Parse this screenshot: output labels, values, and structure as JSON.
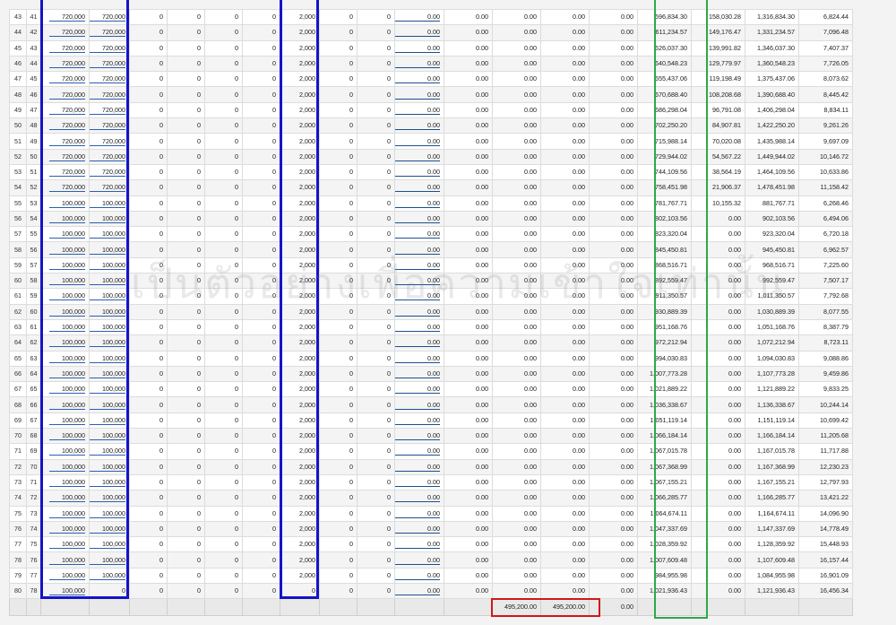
{
  "watermark": "เป็นตัวอย่างเพื่อความเข้าใจเท่านั้น",
  "highlight_colors": {
    "blue": "#1414c8",
    "green": "#2ea84a",
    "red": "#d01818"
  },
  "rows": [
    [
      "43",
      "41",
      "720,000",
      "720,000",
      "0",
      "0",
      "0",
      "0",
      "2,000",
      "0",
      "0",
      "0.00",
      "0.00",
      "0.00",
      "0.00",
      "0.00",
      "596,834.30",
      "158,030.28",
      "1,316,834.30",
      "6,824.44"
    ],
    [
      "44",
      "42",
      "720,000",
      "720,000",
      "0",
      "0",
      "0",
      "0",
      "2,000",
      "0",
      "0",
      "0.00",
      "0.00",
      "0.00",
      "0.00",
      "0.00",
      "611,234.57",
      "149,176.47",
      "1,331,234.57",
      "7,096.48"
    ],
    [
      "45",
      "43",
      "720,000",
      "720,000",
      "0",
      "0",
      "0",
      "0",
      "2,000",
      "0",
      "0",
      "0.00",
      "0.00",
      "0.00",
      "0.00",
      "0.00",
      "626,037.30",
      "139,991.82",
      "1,346,037.30",
      "7,407.37"
    ],
    [
      "46",
      "44",
      "720,000",
      "720,000",
      "0",
      "0",
      "0",
      "0",
      "2,000",
      "0",
      "0",
      "0.00",
      "0.00",
      "0.00",
      "0.00",
      "0.00",
      "640,548.23",
      "129,779.97",
      "1,360,548.23",
      "7,726.05"
    ],
    [
      "47",
      "45",
      "720,000",
      "720,000",
      "0",
      "0",
      "0",
      "0",
      "2,000",
      "0",
      "0",
      "0.00",
      "0.00",
      "0.00",
      "0.00",
      "0.00",
      "655,437.06",
      "119,198.49",
      "1,375,437.06",
      "8,073.62"
    ],
    [
      "48",
      "46",
      "720,000",
      "720,000",
      "0",
      "0",
      "0",
      "0",
      "2,000",
      "0",
      "0",
      "0.00",
      "0.00",
      "0.00",
      "0.00",
      "0.00",
      "670,688.40",
      "108,208.68",
      "1,390,688.40",
      "8,445.42"
    ],
    [
      "49",
      "47",
      "720,000",
      "720,000",
      "0",
      "0",
      "0",
      "0",
      "2,000",
      "0",
      "0",
      "0.00",
      "0.00",
      "0.00",
      "0.00",
      "0.00",
      "686,298.04",
      "96,791.08",
      "1,406,298.04",
      "8,834.11"
    ],
    [
      "50",
      "48",
      "720,000",
      "720,000",
      "0",
      "0",
      "0",
      "0",
      "2,000",
      "0",
      "0",
      "0.00",
      "0.00",
      "0.00",
      "0.00",
      "0.00",
      "702,250.20",
      "84,907.81",
      "1,422,250.20",
      "9,261.26"
    ],
    [
      "51",
      "49",
      "720,000",
      "720,000",
      "0",
      "0",
      "0",
      "0",
      "2,000",
      "0",
      "0",
      "0.00",
      "0.00",
      "0.00",
      "0.00",
      "0.00",
      "715,988.14",
      "70,020.08",
      "1,435,988.14",
      "9,697.09"
    ],
    [
      "52",
      "50",
      "720,000",
      "720,000",
      "0",
      "0",
      "0",
      "0",
      "2,000",
      "0",
      "0",
      "0.00",
      "0.00",
      "0.00",
      "0.00",
      "0.00",
      "729,944.02",
      "54,567.22",
      "1,449,944.02",
      "10,146.72"
    ],
    [
      "53",
      "51",
      "720,000",
      "720,000",
      "0",
      "0",
      "0",
      "0",
      "2,000",
      "0",
      "0",
      "0.00",
      "0.00",
      "0.00",
      "0.00",
      "0.00",
      "744,109.56",
      "38,564.19",
      "1,464,109.56",
      "10,633.86"
    ],
    [
      "54",
      "52",
      "720,000",
      "720,000",
      "0",
      "0",
      "0",
      "0",
      "2,000",
      "0",
      "0",
      "0.00",
      "0.00",
      "0.00",
      "0.00",
      "0.00",
      "758,451.98",
      "21,906.37",
      "1,478,451.98",
      "11,158.42"
    ],
    [
      "55",
      "53",
      "100,000",
      "100,000",
      "0",
      "0",
      "0",
      "0",
      "2,000",
      "0",
      "0",
      "0.00",
      "0.00",
      "0.00",
      "0.00",
      "0.00",
      "781,767.71",
      "10,155.32",
      "881,767.71",
      "6,268.46"
    ],
    [
      "56",
      "54",
      "100,000",
      "100,000",
      "0",
      "0",
      "0",
      "0",
      "2,000",
      "0",
      "0",
      "0.00",
      "0.00",
      "0.00",
      "0.00",
      "0.00",
      "802,103.56",
      "0.00",
      "902,103.56",
      "6,494.06"
    ],
    [
      "57",
      "55",
      "100,000",
      "100,000",
      "0",
      "0",
      "0",
      "0",
      "2,000",
      "0",
      "0",
      "0.00",
      "0.00",
      "0.00",
      "0.00",
      "0.00",
      "823,320.04",
      "0.00",
      "923,320.04",
      "6,720.18"
    ],
    [
      "58",
      "56",
      "100,000",
      "100,000",
      "0",
      "0",
      "0",
      "0",
      "2,000",
      "0",
      "0",
      "0.00",
      "0.00",
      "0.00",
      "0.00",
      "0.00",
      "845,450.81",
      "0.00",
      "945,450.81",
      "6,962.57"
    ],
    [
      "59",
      "57",
      "100,000",
      "100,000",
      "0",
      "0",
      "0",
      "0",
      "2,000",
      "0",
      "0",
      "0.00",
      "0.00",
      "0.00",
      "0.00",
      "0.00",
      "868,516.71",
      "0.00",
      "968,516.71",
      "7,225.60"
    ],
    [
      "60",
      "58",
      "100,000",
      "100,000",
      "0",
      "0",
      "0",
      "0",
      "2,000",
      "0",
      "0",
      "0.00",
      "0.00",
      "0.00",
      "0.00",
      "0.00",
      "892,559.47",
      "0.00",
      "992,559.47",
      "7,507.17"
    ],
    [
      "61",
      "59",
      "100,000",
      "100,000",
      "0",
      "0",
      "0",
      "0",
      "2,000",
      "0",
      "0",
      "0.00",
      "0.00",
      "0.00",
      "0.00",
      "0.00",
      "911,350.57",
      "0.00",
      "1,011,350.57",
      "7,792.68"
    ],
    [
      "62",
      "60",
      "100,000",
      "100,000",
      "0",
      "0",
      "0",
      "0",
      "2,000",
      "0",
      "0",
      "0.00",
      "0.00",
      "0.00",
      "0.00",
      "0.00",
      "930,889.39",
      "0.00",
      "1,030,889.39",
      "8,077.55"
    ],
    [
      "63",
      "61",
      "100,000",
      "100,000",
      "0",
      "0",
      "0",
      "0",
      "2,000",
      "0",
      "0",
      "0.00",
      "0.00",
      "0.00",
      "0.00",
      "0.00",
      "951,168.76",
      "0.00",
      "1,051,168.76",
      "8,387.79"
    ],
    [
      "64",
      "62",
      "100,000",
      "100,000",
      "0",
      "0",
      "0",
      "0",
      "2,000",
      "0",
      "0",
      "0.00",
      "0.00",
      "0.00",
      "0.00",
      "0.00",
      "972,212.94",
      "0.00",
      "1,072,212.94",
      "8,723.11"
    ],
    [
      "65",
      "63",
      "100,000",
      "100,000",
      "0",
      "0",
      "0",
      "0",
      "2,000",
      "0",
      "0",
      "0.00",
      "0.00",
      "0.00",
      "0.00",
      "0.00",
      "994,030.83",
      "0.00",
      "1,094,030.83",
      "9,088.86"
    ],
    [
      "66",
      "64",
      "100,000",
      "100,000",
      "0",
      "0",
      "0",
      "0",
      "2,000",
      "0",
      "0",
      "0.00",
      "0.00",
      "0.00",
      "0.00",
      "0.00",
      "1,007,773.28",
      "0.00",
      "1,107,773.28",
      "9,459.86"
    ],
    [
      "67",
      "65",
      "100,000",
      "100,000",
      "0",
      "0",
      "0",
      "0",
      "2,000",
      "0",
      "0",
      "0.00",
      "0.00",
      "0.00",
      "0.00",
      "0.00",
      "1,021,889.22",
      "0.00",
      "1,121,889.22",
      "9,833.25"
    ],
    [
      "68",
      "66",
      "100,000",
      "100,000",
      "0",
      "0",
      "0",
      "0",
      "2,000",
      "0",
      "0",
      "0.00",
      "0.00",
      "0.00",
      "0.00",
      "0.00",
      "1,036,338.67",
      "0.00",
      "1,136,338.67",
      "10,244.14"
    ],
    [
      "69",
      "67",
      "100,000",
      "100,000",
      "0",
      "0",
      "0",
      "0",
      "2,000",
      "0",
      "0",
      "0.00",
      "0.00",
      "0.00",
      "0.00",
      "0.00",
      "1,051,119.14",
      "0.00",
      "1,151,119.14",
      "10,699.42"
    ],
    [
      "70",
      "68",
      "100,000",
      "100,000",
      "0",
      "0",
      "0",
      "0",
      "2,000",
      "0",
      "0",
      "0.00",
      "0.00",
      "0.00",
      "0.00",
      "0.00",
      "1,066,184.14",
      "0.00",
      "1,166,184.14",
      "11,205.68"
    ],
    [
      "71",
      "69",
      "100,000",
      "100,000",
      "0",
      "0",
      "0",
      "0",
      "2,000",
      "0",
      "0",
      "0.00",
      "0.00",
      "0.00",
      "0.00",
      "0.00",
      "1,067,015.78",
      "0.00",
      "1,167,015.78",
      "11,717.88"
    ],
    [
      "72",
      "70",
      "100,000",
      "100,000",
      "0",
      "0",
      "0",
      "0",
      "2,000",
      "0",
      "0",
      "0.00",
      "0.00",
      "0.00",
      "0.00",
      "0.00",
      "1,067,368.99",
      "0.00",
      "1,167,368.99",
      "12,230.23"
    ],
    [
      "73",
      "71",
      "100,000",
      "100,000",
      "0",
      "0",
      "0",
      "0",
      "2,000",
      "0",
      "0",
      "0.00",
      "0.00",
      "0.00",
      "0.00",
      "0.00",
      "1,067,155.21",
      "0.00",
      "1,167,155.21",
      "12,797.93"
    ],
    [
      "74",
      "72",
      "100,000",
      "100,000",
      "0",
      "0",
      "0",
      "0",
      "2,000",
      "0",
      "0",
      "0.00",
      "0.00",
      "0.00",
      "0.00",
      "0.00",
      "1,066,285.77",
      "0.00",
      "1,166,285.77",
      "13,421.22"
    ],
    [
      "75",
      "73",
      "100,000",
      "100,000",
      "0",
      "0",
      "0",
      "0",
      "2,000",
      "0",
      "0",
      "0.00",
      "0.00",
      "0.00",
      "0.00",
      "0.00",
      "1,064,674.11",
      "0.00",
      "1,164,674.11",
      "14,096.90"
    ],
    [
      "76",
      "74",
      "100,000",
      "100,000",
      "0",
      "0",
      "0",
      "0",
      "2,000",
      "0",
      "0",
      "0.00",
      "0.00",
      "0.00",
      "0.00",
      "0.00",
      "1,047,337.69",
      "0.00",
      "1,147,337.69",
      "14,778.49"
    ],
    [
      "77",
      "75",
      "100,000",
      "100,000",
      "0",
      "0",
      "0",
      "0",
      "2,000",
      "0",
      "0",
      "0.00",
      "0.00",
      "0.00",
      "0.00",
      "0.00",
      "1,028,359.92",
      "0.00",
      "1,128,359.92",
      "15,448.93"
    ],
    [
      "78",
      "76",
      "100,000",
      "100,000",
      "0",
      "0",
      "0",
      "0",
      "2,000",
      "0",
      "0",
      "0.00",
      "0.00",
      "0.00",
      "0.00",
      "0.00",
      "1,007,609.48",
      "0.00",
      "1,107,609.48",
      "16,157.44"
    ],
    [
      "79",
      "77",
      "100,000",
      "100,000",
      "0",
      "0",
      "0",
      "0",
      "2,000",
      "0",
      "0",
      "0.00",
      "0.00",
      "0.00",
      "0.00",
      "0.00",
      "984,955.98",
      "0.00",
      "1,084,955.98",
      "16,901.09"
    ],
    [
      "80",
      "78",
      "100,000",
      "0",
      "0",
      "0",
      "0",
      "0",
      "0",
      "0",
      "0",
      "0.00",
      "0.00",
      "0.00",
      "0.00",
      "0.00",
      "1,021,936.43",
      "0.00",
      "1,121,936.43",
      "16,456.34"
    ]
  ],
  "totals": [
    "",
    "",
    "",
    "",
    "",
    "",
    "",
    "",
    "",
    "",
    "",
    "",
    "",
    "495,200.00",
    "495,200.00",
    "0.00",
    "",
    "",
    "",
    ""
  ]
}
